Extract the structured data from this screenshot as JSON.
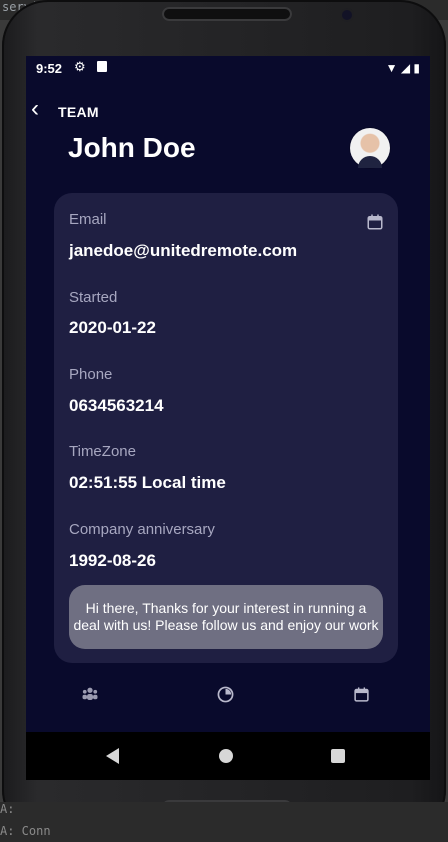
{
  "ide": {
    "top_text": "servi",
    "bottom_line1": "A:",
    "bottom_line2": "A: Conn"
  },
  "status": {
    "time": "9:52",
    "icons": [
      "gear-icon",
      "sd-card-icon",
      "wifi-icon",
      "signal-icon",
      "battery-icon"
    ]
  },
  "header": {
    "back_icon": "chevron-left-icon",
    "title": "TEAM",
    "name": "John Doe"
  },
  "profile": {
    "fields": [
      {
        "label": "Email",
        "value": "janedoe@unitedremote.com"
      },
      {
        "label": "Started",
        "value": "2020-01-22"
      },
      {
        "label": "Phone",
        "value": "0634563214"
      },
      {
        "label": "TimeZone",
        "value": "02:51:55 Local time"
      },
      {
        "label": "Company anniversary",
        "value": "1992-08-26"
      }
    ],
    "message": "Hi there, Thanks for your interest in running a deal with us! Please follow us and enjoy our work"
  },
  "tabs": [
    {
      "icon": "people-icon"
    },
    {
      "icon": "clock-icon"
    },
    {
      "icon": "calendar-icon"
    }
  ],
  "colors": {
    "screen_bg": "#090a2c",
    "card_bg": "#1f1f42",
    "message_bg": "#6f6f82",
    "label": "#a7a7c0"
  }
}
